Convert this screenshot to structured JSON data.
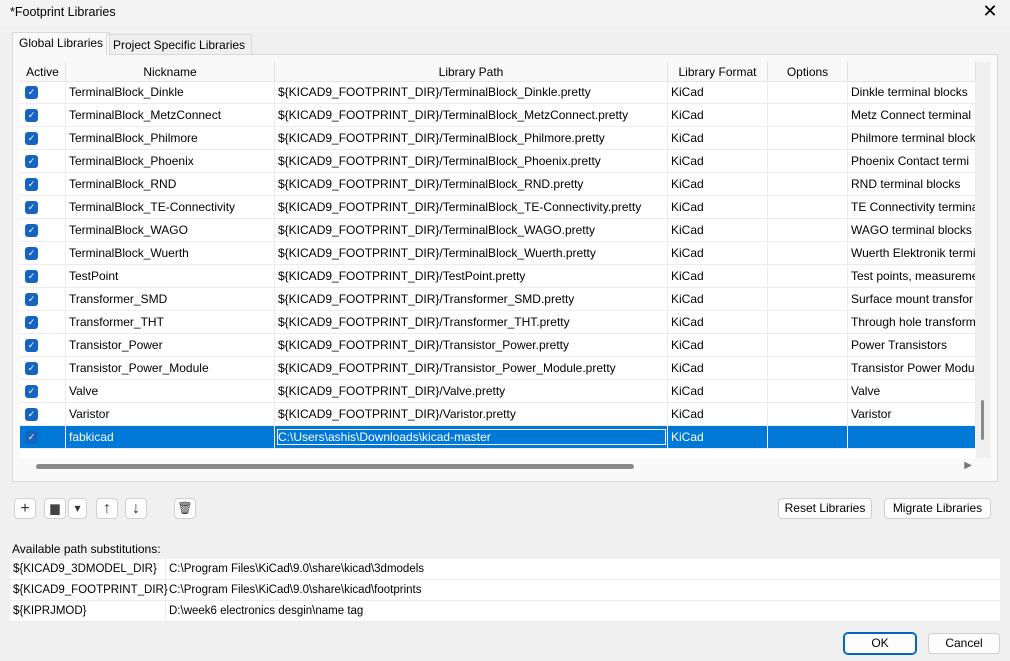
{
  "window": {
    "title": "*Footprint Libraries",
    "close": "✕"
  },
  "tabs": [
    "Global Libraries",
    "Project Specific Libraries"
  ],
  "columns": [
    "Active",
    "Nickname",
    "Library Path",
    "Library Format",
    "Options",
    ""
  ],
  "rows": [
    {
      "nick": "TerminalBlock_Dinkle",
      "path": "${KICAD9_FOOTPRINT_DIR}/TerminalBlock_Dinkle.pretty",
      "format": "KiCad",
      "options": "",
      "desc": "Dinkle terminal blocks"
    },
    {
      "nick": "TerminalBlock_MetzConnect",
      "path": "${KICAD9_FOOTPRINT_DIR}/TerminalBlock_MetzConnect.pretty",
      "format": "KiCad",
      "options": "",
      "desc": "Metz Connect terminal"
    },
    {
      "nick": "TerminalBlock_Philmore",
      "path": "${KICAD9_FOOTPRINT_DIR}/TerminalBlock_Philmore.pretty",
      "format": "KiCad",
      "options": "",
      "desc": "Philmore terminal block"
    },
    {
      "nick": "TerminalBlock_Phoenix",
      "path": "${KICAD9_FOOTPRINT_DIR}/TerminalBlock_Phoenix.pretty",
      "format": "KiCad",
      "options": "",
      "desc": "Phoenix Contact termi"
    },
    {
      "nick": "TerminalBlock_RND",
      "path": "${KICAD9_FOOTPRINT_DIR}/TerminalBlock_RND.pretty",
      "format": "KiCad",
      "options": "",
      "desc": "RND terminal blocks"
    },
    {
      "nick": "TerminalBlock_TE-Connectivity",
      "path": "${KICAD9_FOOTPRINT_DIR}/TerminalBlock_TE-Connectivity.pretty",
      "format": "KiCad",
      "options": "",
      "desc": "TE Connectivity termina"
    },
    {
      "nick": "TerminalBlock_WAGO",
      "path": "${KICAD9_FOOTPRINT_DIR}/TerminalBlock_WAGO.pretty",
      "format": "KiCad",
      "options": "",
      "desc": "WAGO terminal blocks"
    },
    {
      "nick": "TerminalBlock_Wuerth",
      "path": "${KICAD9_FOOTPRINT_DIR}/TerminalBlock_Wuerth.pretty",
      "format": "KiCad",
      "options": "",
      "desc": "Wuerth Elektronik termi"
    },
    {
      "nick": "TestPoint",
      "path": "${KICAD9_FOOTPRINT_DIR}/TestPoint.pretty",
      "format": "KiCad",
      "options": "",
      "desc": "Test points, measureme"
    },
    {
      "nick": "Transformer_SMD",
      "path": "${KICAD9_FOOTPRINT_DIR}/Transformer_SMD.pretty",
      "format": "KiCad",
      "options": "",
      "desc": "Surface mount transfor"
    },
    {
      "nick": "Transformer_THT",
      "path": "${KICAD9_FOOTPRINT_DIR}/Transformer_THT.pretty",
      "format": "KiCad",
      "options": "",
      "desc": "Through hole transform"
    },
    {
      "nick": "Transistor_Power",
      "path": "${KICAD9_FOOTPRINT_DIR}/Transistor_Power.pretty",
      "format": "KiCad",
      "options": "",
      "desc": "Power Transistors"
    },
    {
      "nick": "Transistor_Power_Module",
      "path": "${KICAD9_FOOTPRINT_DIR}/Transistor_Power_Module.pretty",
      "format": "KiCad",
      "options": "",
      "desc": "Transistor Power Modu"
    },
    {
      "nick": "Valve",
      "path": "${KICAD9_FOOTPRINT_DIR}/Valve.pretty",
      "format": "KiCad",
      "options": "",
      "desc": "Valve"
    },
    {
      "nick": "Varistor",
      "path": "${KICAD9_FOOTPRINT_DIR}/Varistor.pretty",
      "format": "KiCad",
      "options": "",
      "desc": "Varistor"
    },
    {
      "nick": "fabkicad",
      "path": "C:\\Users\\ashis\\Downloads\\kicad-master",
      "format": "KiCad",
      "options": "",
      "desc": "",
      "selected": true
    }
  ],
  "toolbar": {
    "add": "+",
    "folder": "▆",
    "dropdown": "▾",
    "up": "↑",
    "down": "↓",
    "delete": "🗑",
    "reset": "Reset Libraries",
    "migrate": "Migrate Libraries"
  },
  "substitutions": {
    "label": "Available path substitutions:",
    "items": [
      {
        "key": "${KICAD9_3DMODEL_DIR}",
        "value": "C:\\Program Files\\KiCad\\9.0\\share\\kicad\\3dmodels"
      },
      {
        "key": "${KICAD9_FOOTPRINT_DIR}",
        "value": "C:\\Program Files\\KiCad\\9.0\\share\\kicad\\footprints"
      },
      {
        "key": "${KIPRJMOD}",
        "value": "D:\\week6 electronics desgin\\name tag"
      }
    ]
  },
  "footer": {
    "ok": "OK",
    "cancel": "Cancel"
  },
  "colors": {
    "selection": "#0078d7",
    "checkbox": "#1565c0"
  }
}
